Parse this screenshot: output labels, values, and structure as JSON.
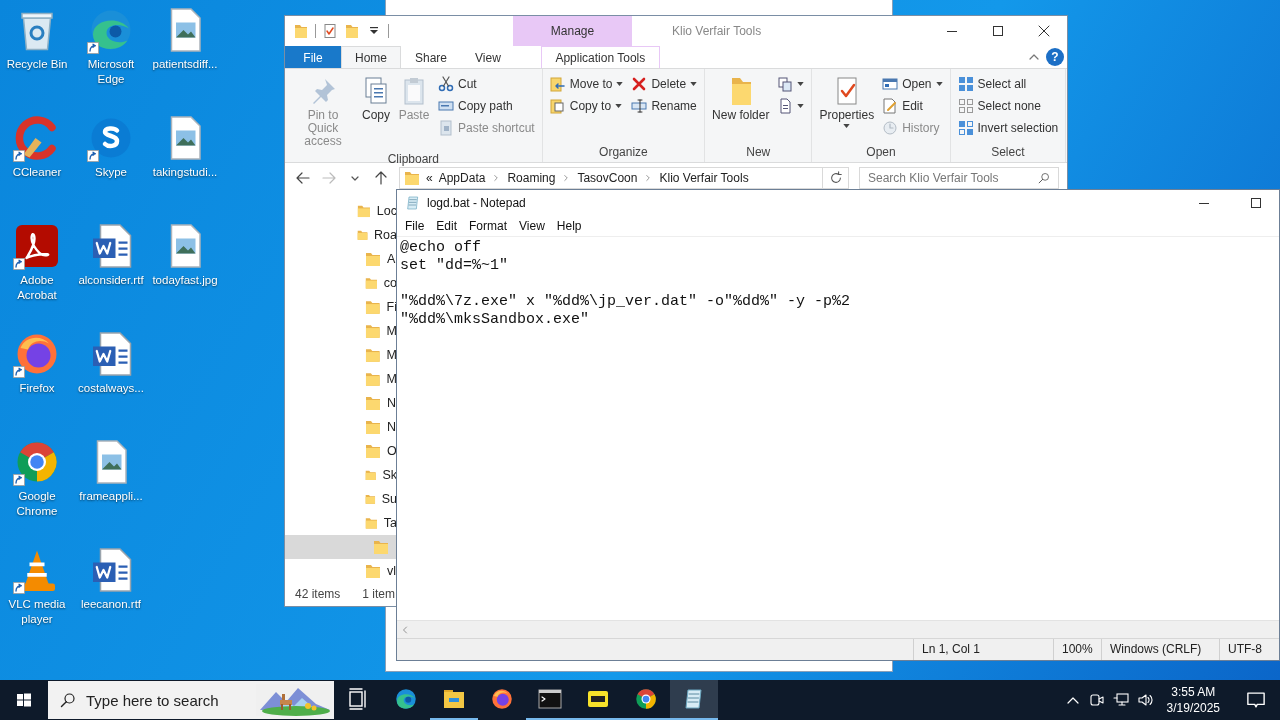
{
  "desktop_icons": [
    {
      "label": "Recycle Bin",
      "kind": "recycle-bin",
      "shortcut": false
    },
    {
      "label": "CCleaner",
      "kind": "ccleaner",
      "shortcut": true
    },
    {
      "label": "Adobe Acrobat",
      "kind": "acrobat",
      "shortcut": true
    },
    {
      "label": "Firefox",
      "kind": "firefox",
      "shortcut": true
    },
    {
      "label": "Google Chrome",
      "kind": "chrome",
      "shortcut": true
    },
    {
      "label": "VLC media player",
      "kind": "vlc",
      "shortcut": true
    },
    {
      "label": "Microsoft Edge",
      "kind": "edge",
      "shortcut": true
    },
    {
      "label": "Skype",
      "kind": "skype",
      "shortcut": true
    },
    {
      "label": "alconsider.rtf",
      "kind": "word-document",
      "shortcut": false
    },
    {
      "label": "costalways...",
      "kind": "word-document",
      "shortcut": false
    },
    {
      "label": "frameappli...",
      "kind": "image-file",
      "shortcut": false
    },
    {
      "label": "leecanon.rtf",
      "kind": "word-document",
      "shortcut": false
    },
    {
      "label": "patientsdiff...",
      "kind": "image-file",
      "shortcut": false
    },
    {
      "label": "takingstudi...",
      "kind": "image-file",
      "shortcut": false
    },
    {
      "label": "todayfast.jpg",
      "kind": "image-file",
      "shortcut": false
    }
  ],
  "explorer": {
    "context_tab": "Manage",
    "title": "Klio Verfair Tools",
    "help": "?",
    "tabs": [
      {
        "label": "File",
        "kind": "file",
        "selected": false
      },
      {
        "label": "Home",
        "kind": "tab",
        "selected": true
      },
      {
        "label": "Share",
        "kind": "tab",
        "selected": false
      },
      {
        "label": "View",
        "kind": "tab",
        "selected": false
      },
      {
        "label": "Application Tools",
        "kind": "context",
        "selected": false
      }
    ],
    "ribbon_groups": [
      {
        "label": "Clipboard",
        "columns": [
          {
            "kind": "large",
            "commands": [
              {
                "label": "Pin to Quick access",
                "disabled": true,
                "menu": false
              },
              {
                "label": "Copy",
                "disabled": false,
                "menu": false
              },
              {
                "label": "Paste",
                "disabled": true,
                "menu": false
              }
            ]
          },
          {
            "kind": "small",
            "commands": [
              {
                "label": "Cut",
                "disabled": false,
                "menu": false
              },
              {
                "label": "Copy path",
                "disabled": false,
                "menu": false
              },
              {
                "label": "Paste shortcut",
                "disabled": true,
                "menu": false
              }
            ]
          }
        ]
      },
      {
        "label": "Organize",
        "columns": [
          {
            "kind": "small",
            "commands": [
              {
                "label": "Move to",
                "disabled": false,
                "menu": true
              },
              {
                "label": "Copy to",
                "disabled": false,
                "menu": true
              }
            ]
          },
          {
            "kind": "small",
            "commands": [
              {
                "label": "Delete",
                "disabled": false,
                "menu": true
              },
              {
                "label": "Rename",
                "disabled": false,
                "menu": false
              }
            ]
          }
        ]
      },
      {
        "label": "New",
        "columns": [
          {
            "kind": "large",
            "commands": [
              {
                "label": "New folder",
                "disabled": false,
                "menu": false
              }
            ]
          },
          {
            "kind": "small",
            "commands": [
              {
                "disabled": false,
                "menu": true
              },
              {
                "disabled": false,
                "menu": true
              }
            ]
          }
        ]
      },
      {
        "label": "Open",
        "columns": [
          {
            "kind": "large",
            "commands": [
              {
                "label": "Properties",
                "disabled": false,
                "menu": true
              }
            ]
          },
          {
            "kind": "small",
            "commands": [
              {
                "label": "Open",
                "disabled": false,
                "menu": true
              },
              {
                "label": "Edit",
                "disabled": false,
                "menu": false
              },
              {
                "label": "History",
                "disabled": true,
                "menu": false
              }
            ]
          }
        ]
      },
      {
        "label": "Select",
        "columns": [
          {
            "kind": "small",
            "commands": [
              {
                "label": "Select all",
                "disabled": false,
                "menu": false
              },
              {
                "label": "Select none",
                "disabled": false,
                "menu": false
              },
              {
                "label": "Invert selection",
                "disabled": false,
                "menu": false
              }
            ]
          }
        ]
      }
    ],
    "address": {
      "overflow_mark": "«",
      "segments": [
        "AppData",
        "Roaming",
        "TasovCoon",
        "Klio Verfair Tools"
      ]
    },
    "search": {
      "placeholder": "Search Klio Verfair Tools"
    },
    "tree": [
      {
        "label": "Loc",
        "selected": false
      },
      {
        "label": "Roa",
        "selected": false,
        "children": [
          {
            "label": "A",
            "selected": false
          },
          {
            "label": "co",
            "selected": false
          },
          {
            "label": "Fi",
            "selected": false
          },
          {
            "label": "M",
            "selected": false
          },
          {
            "label": "M",
            "selected": false
          },
          {
            "label": "M",
            "selected": false
          },
          {
            "label": "N",
            "selected": false
          },
          {
            "label": "N",
            "selected": false
          },
          {
            "label": "O",
            "selected": false
          },
          {
            "label": "Sk",
            "selected": false
          },
          {
            "label": "Su",
            "selected": false
          },
          {
            "label": "Ta",
            "selected": false,
            "children": [
              {
                "selected": true
              }
            ]
          },
          {
            "label": "vl",
            "selected": false
          }
        ]
      }
    ],
    "status": [
      "42 items",
      "1 item"
    ]
  },
  "notepad": {
    "title": "logd.bat - Notepad",
    "menu": [
      "File",
      "Edit",
      "Format",
      "View",
      "Help"
    ],
    "text": "@echo off\nset \"dd=%~1\"\n\n\"%dd%\\7z.exe\" x \"%dd%\\jp_ver.dat\" -o\"%dd%\" -y -p%2\n\"%dd%\\mksSandbox.exe\"",
    "status": {
      "position": "Ln 1, Col 1",
      "zoom": "100%",
      "line_ending": "Windows (CRLF)",
      "encoding": "UTF-8"
    }
  },
  "taskbar": {
    "search_placeholder": "Type here to search",
    "apps": [
      {
        "kind": "task-view",
        "running": false,
        "selected": false
      },
      {
        "kind": "edge",
        "running": false,
        "selected": false
      },
      {
        "kind": "explorer",
        "running": true,
        "selected": false
      },
      {
        "kind": "firefox",
        "running": false,
        "selected": false
      },
      {
        "kind": "terminal",
        "running": true,
        "selected": false
      },
      {
        "kind": "pdf",
        "running": true,
        "selected": false
      },
      {
        "kind": "chrome",
        "running": true,
        "selected": false
      },
      {
        "kind": "notepad",
        "running": true,
        "selected": true
      }
    ],
    "clock": {
      "time": "3:55 AM",
      "date": "3/19/2025"
    }
  }
}
